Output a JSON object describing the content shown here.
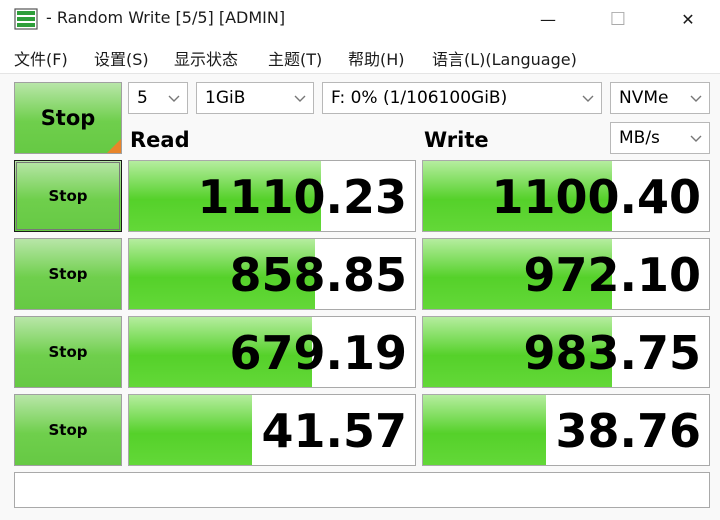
{
  "window": {
    "title": "- Random Write [5/5] [ADMIN]",
    "minimize_glyph": "—",
    "maximize_glyph": "☐",
    "close_glyph": "✕"
  },
  "menu": [
    {
      "label": "文件(F)"
    },
    {
      "label": "设置(S)"
    },
    {
      "label": "显示状态"
    },
    {
      "label": "主题(T)"
    },
    {
      "label": "帮助(H)"
    },
    {
      "label": "语言(L)(Language)"
    }
  ],
  "controls": {
    "main_button": "Stop",
    "count": "5",
    "size": "1GiB",
    "drive": "F: 0% (1/106100GiB)",
    "profile": "NVMe",
    "unit": "MB/s"
  },
  "headers": {
    "read": "Read",
    "write": "Write"
  },
  "rows": [
    {
      "button": "Stop",
      "read": "1110.23",
      "read_fill": 0.67,
      "write": "1100.40",
      "write_fill": 0.66
    },
    {
      "button": "Stop",
      "read": "858.85",
      "read_fill": 0.65,
      "write": "972.10",
      "write_fill": 0.66
    },
    {
      "button": "Stop",
      "read": "679.19",
      "read_fill": 0.64,
      "write": "983.75",
      "write_fill": 0.66
    },
    {
      "button": "Stop",
      "read": "41.57",
      "read_fill": 0.43,
      "write": "38.76",
      "write_fill": 0.43
    }
  ],
  "colors": {
    "bar_green": "#55d12a",
    "button_green": "#6fcf4c",
    "accent_orange": "#e8852a"
  },
  "icons": {
    "app": "disk-app-icon",
    "chevron": "chevron-down-icon"
  }
}
